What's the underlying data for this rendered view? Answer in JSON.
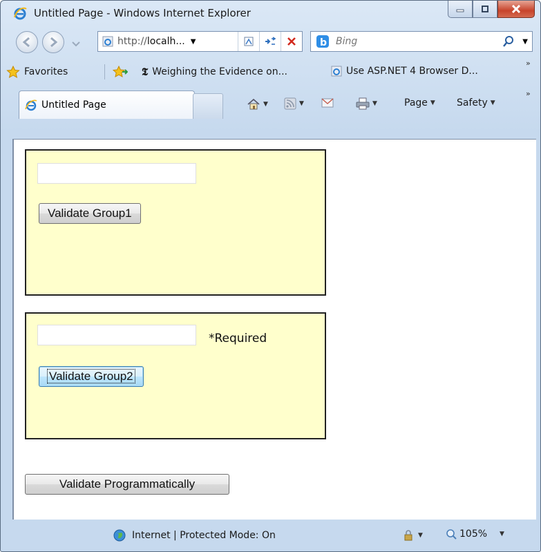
{
  "window": {
    "title": "Untitled Page - Windows Internet Explorer",
    "accent": "#c7442c"
  },
  "nav": {
    "address": "http://localh...",
    "address_prefix": "http://",
    "address_host": "localh...",
    "search_placeholder": "Bing"
  },
  "favorites": {
    "label": "Favorites",
    "items": [
      {
        "label": "Weighing the Evidence on...",
        "icon": "nyt-icon"
      },
      {
        "label": "Use ASP.NET 4 Browser D...",
        "icon": "ie-page-icon"
      }
    ],
    "overflow": "»"
  },
  "tabs": [
    {
      "label": "Untitled Page"
    }
  ],
  "command_bar": {
    "page_label": "Page",
    "safety_label": "Safety",
    "overflow": "»"
  },
  "form": {
    "group1": {
      "input_value": "",
      "button": "Validate Group1"
    },
    "group2": {
      "input_value": "",
      "validator": "*Required",
      "button": "Validate Group2"
    },
    "programmatic_button": "Validate Programmatically"
  },
  "status": {
    "zone": "Internet | Protected Mode: On",
    "zoom": "105%"
  },
  "colors": {
    "panel_bg": "#ffffcc",
    "panel_border": "#222222"
  }
}
